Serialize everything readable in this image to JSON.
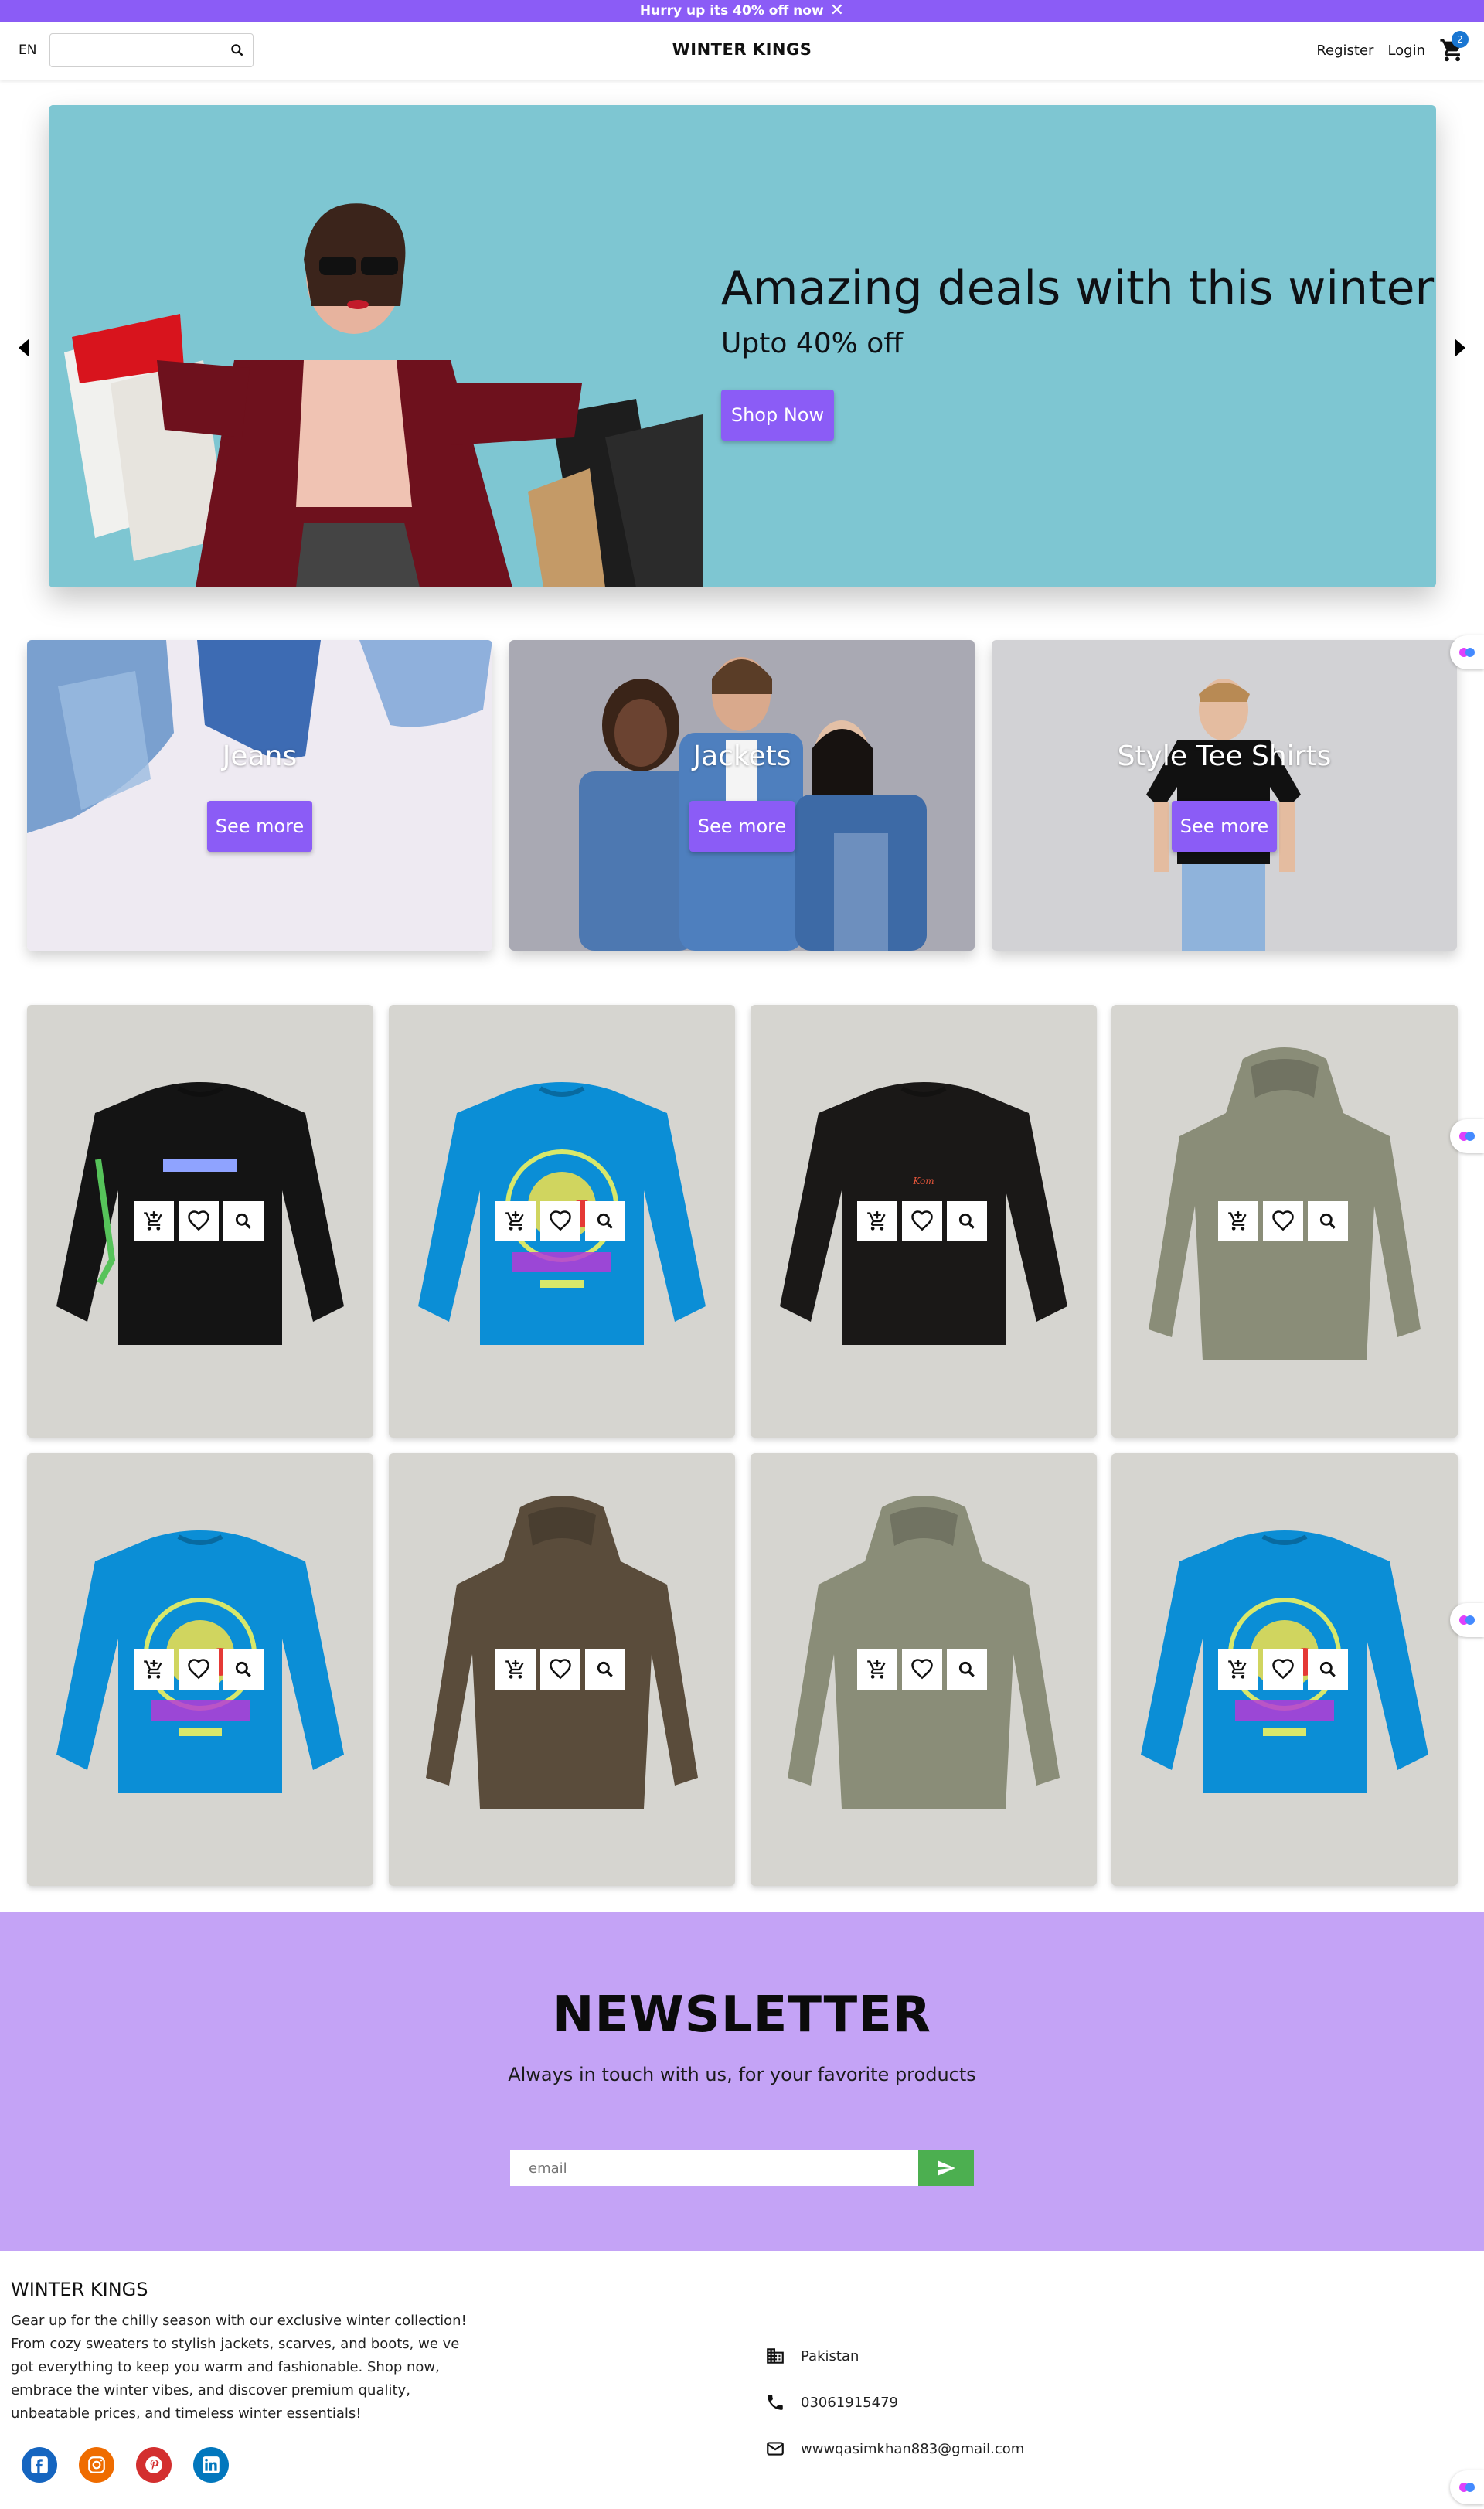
{
  "promo": {
    "text": "Hurry up its 40% off now"
  },
  "nav": {
    "lang": "EN",
    "brand": "WINTER KINGS",
    "register": "Register",
    "login": "Login",
    "cart_count": "2"
  },
  "hero": {
    "title": "Amazing deals with this winter",
    "subtitle": "Upto 40% off",
    "cta": "Shop Now"
  },
  "categories": [
    {
      "title": "Jeans",
      "cta": "See more"
    },
    {
      "title": "Jackets",
      "cta": "See more"
    },
    {
      "title": "Style Tee Shirts",
      "cta": "See more"
    }
  ],
  "products": [
    {
      "item": "black-longsleeve",
      "color": "#141414"
    },
    {
      "item": "blue-longsleeve",
      "color": "#0b8ed6"
    },
    {
      "item": "black-longsleeve",
      "color": "#1a1817"
    },
    {
      "item": "sage-hoodie",
      "color": "#8a8d78"
    },
    {
      "item": "blue-longsleeve",
      "color": "#0b8ed6"
    },
    {
      "item": "brown-hoodie",
      "color": "#5a4c3b"
    },
    {
      "item": "sage-hoodie",
      "color": "#8a8d78"
    },
    {
      "item": "blue-longsleeve",
      "color": "#0b8ed6"
    }
  ],
  "newsletter": {
    "title": "NEWSLETTER",
    "subtitle": "Always in touch with us, for your favorite products",
    "placeholder": "email"
  },
  "footer": {
    "brand": "WINTER KINGS",
    "description": "Gear up for the chilly season with our exclusive winter collection! From cozy sweaters to stylish jackets, scarves, and boots, we ve got everything to keep you warm and fashionable. Shop now, embrace the winter vibes, and discover premium quality, unbeatable prices, and timeless winter essentials!",
    "country": "Pakistan",
    "phone": "03061915479",
    "email": "wwwqasimkhan883@gmail.com"
  },
  "colors": {
    "accent": "#8b5cf6",
    "hero_bg": "#7ec6d2",
    "newsletter_bg": "#c4a3f6",
    "send_button": "#4caf50",
    "product_bg": "#d6d5d0",
    "badge": "#1976d2"
  }
}
